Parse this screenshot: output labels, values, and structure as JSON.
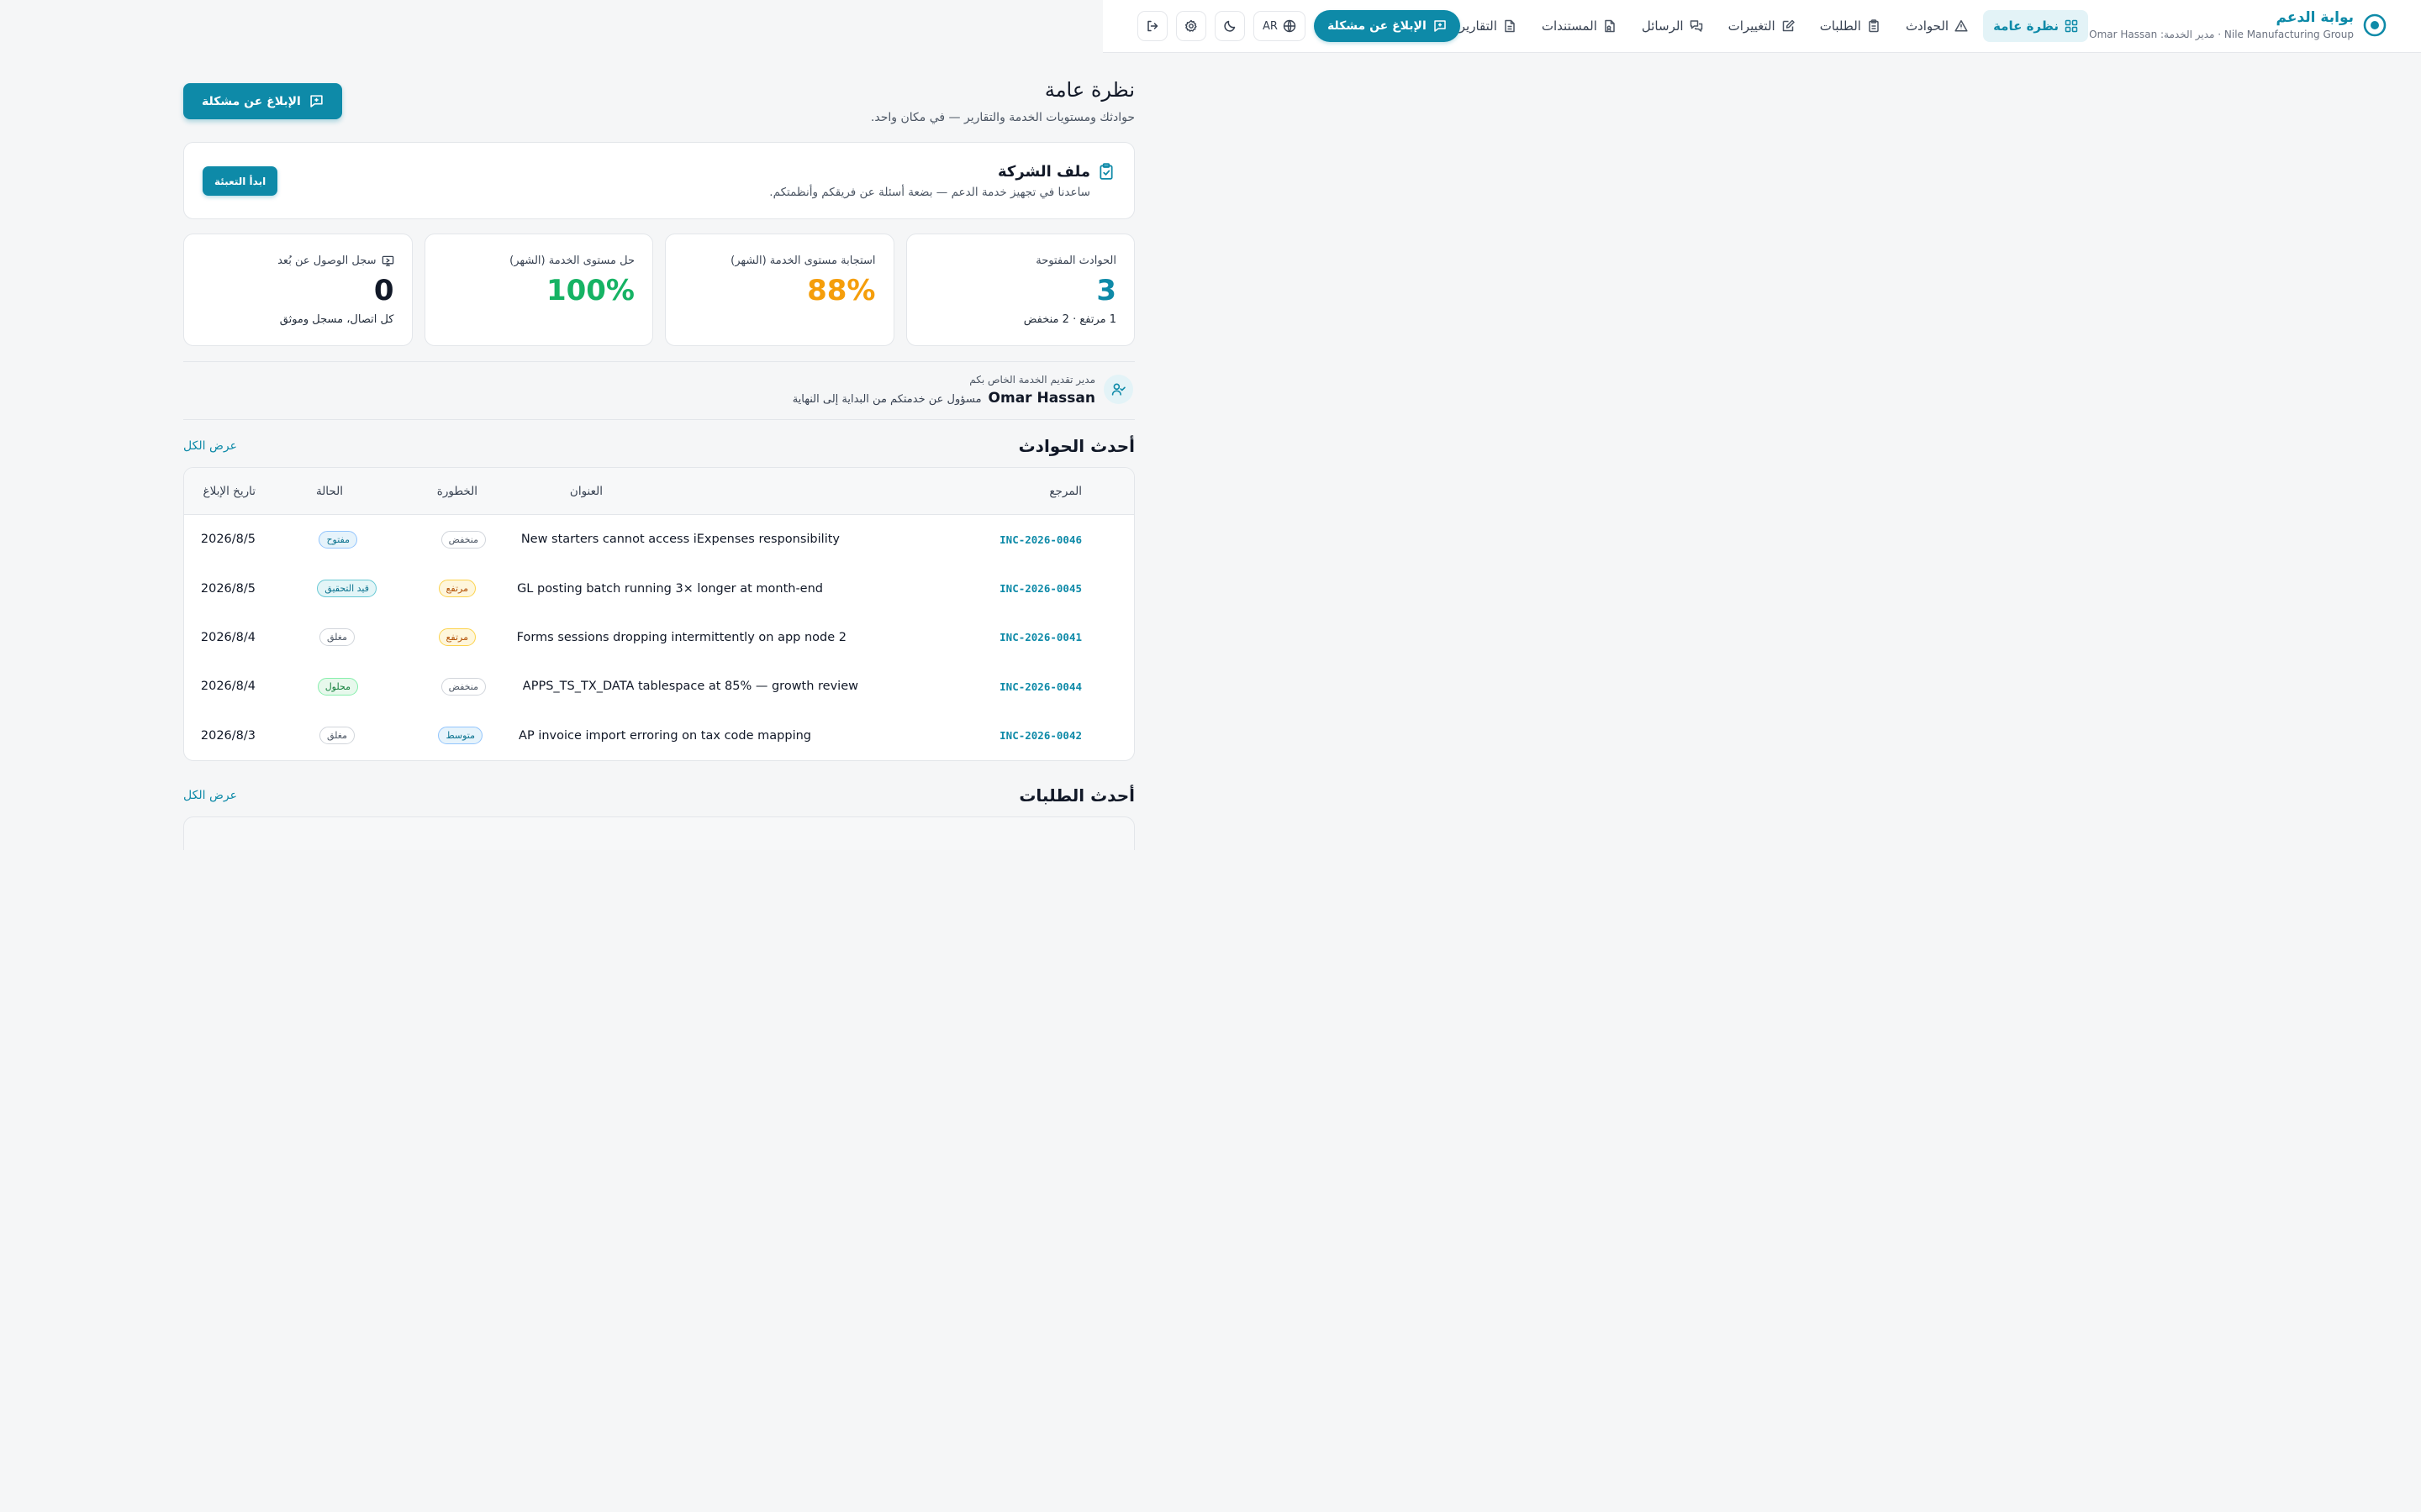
{
  "brand": {
    "title": "بوابة الدعم",
    "subtitle": "Nile Manufacturing Group · مدير الخدمة: Omar Hassan"
  },
  "nav": [
    {
      "label": "نظرة عامة",
      "icon": "grid-icon",
      "active": true
    },
    {
      "label": "الحوادث",
      "icon": "alert-triangle-icon"
    },
    {
      "label": "الطلبات",
      "icon": "clipboard-icon"
    },
    {
      "label": "التغييرات",
      "icon": "edit-icon"
    },
    {
      "label": "الرسائل",
      "icon": "messages-icon"
    },
    {
      "label": "المستندات",
      "icon": "file-icon"
    },
    {
      "label": "التقارير",
      "icon": "document-icon"
    }
  ],
  "topbar": {
    "report_label": "الإبلاغ عن مشكلة",
    "lang_label": "AR"
  },
  "page": {
    "title": "نظرة عامة",
    "subtitle": "حوادثك ومستويات الخدمة والتقارير — في مكان واحد.",
    "report_label": "الإبلاغ عن مشكلة"
  },
  "profile": {
    "title": "ملف الشركة",
    "description": "ساعدنا في تجهيز خدمة الدعم — بضعة أسئلة عن فريقكم وأنظمتكم.",
    "button_label": "ابدأ التعبئة"
  },
  "stats": [
    {
      "label": "الحوادث المفتوحة",
      "value": "3",
      "note": "1 مرتفع · 2 منخفض",
      "color": "#0e8aa8"
    },
    {
      "label": "استجابة مستوى الخدمة (الشهر)",
      "value": "88%",
      "note": "",
      "color": "#f59e0b"
    },
    {
      "label": "حل مستوى الخدمة (الشهر)",
      "value": "100%",
      "note": "",
      "color": "#16b364"
    },
    {
      "label": "سجل الوصول عن بُعد",
      "value": "0",
      "note": "كل اتصال، مسجل وموثق",
      "color": "#111827"
    }
  ],
  "manager": {
    "label": "مدير تقديم الخدمة الخاص بكم",
    "name": "Omar Hassan",
    "description": "مسؤول عن خدمتكم من البداية إلى النهاية"
  },
  "incidents": {
    "title": "أحدث الحوادث",
    "view_all": "عرض الكل",
    "columns": {
      "ref": "المرجع",
      "title": "العنوان",
      "severity": "الخطورة",
      "status": "الحالة",
      "date": "تاريخ الإبلاغ"
    },
    "rows": [
      {
        "ref": "INC-2026-0046",
        "title": "New starters cannot access iExpenses responsibility",
        "severity": "منخفض",
        "status": "مفتوح",
        "date": "2026/8/5"
      },
      {
        "ref": "INC-2026-0045",
        "title": "GL posting batch running 3× longer at month-end",
        "severity": "مرتفع",
        "status": "قيد التحقيق",
        "date": "2026/8/5"
      },
      {
        "ref": "INC-2026-0041",
        "title": "Forms sessions dropping intermittently on app node 2",
        "severity": "مرتفع",
        "status": "مغلق",
        "date": "2026/8/4"
      },
      {
        "ref": "INC-2026-0044",
        "title": "APPS_TS_TX_DATA tablespace at 85% — growth review",
        "severity": "منخفض",
        "status": "محلول",
        "date": "2026/8/4"
      },
      {
        "ref": "INC-2026-0042",
        "title": "AP invoice import erroring on tax code mapping",
        "severity": "متوسط",
        "status": "مغلق",
        "date": "2026/8/3"
      }
    ]
  },
  "requests": {
    "title": "أحدث الطلبات",
    "view_all": "عرض الكل"
  }
}
